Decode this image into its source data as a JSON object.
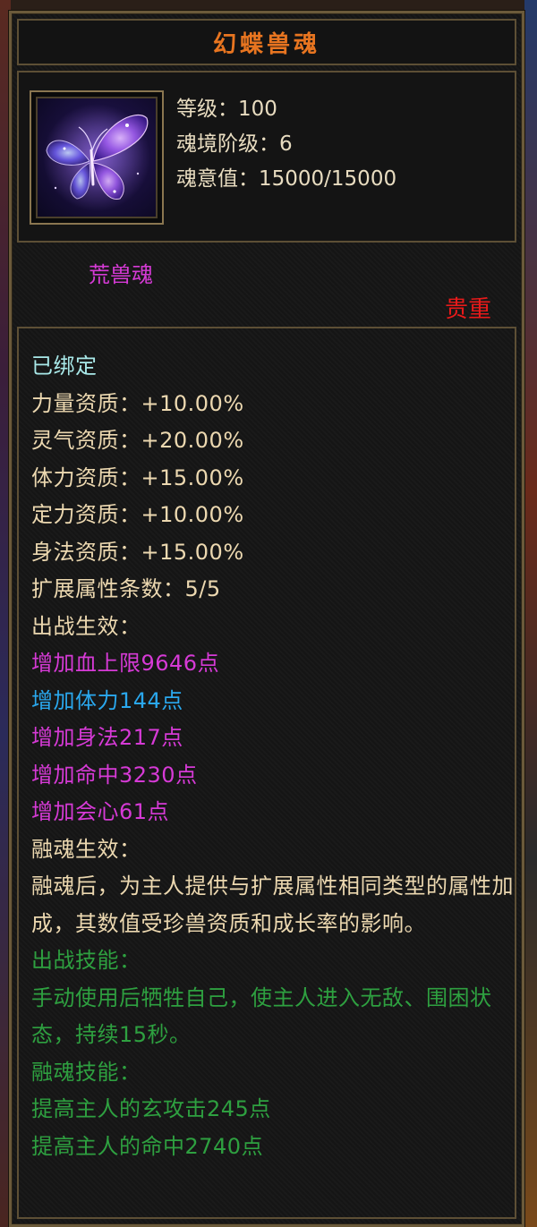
{
  "item": {
    "name": "幻蝶兽魂",
    "icon": "butterfly-soul-icon",
    "stats": [
      "等级：100",
      "魂境阶级：6",
      "魂意值：15000/15000"
    ],
    "category": "荒兽魂",
    "preciousness": "贵重"
  },
  "details": {
    "bound": "已绑定",
    "aptitudes": [
      "力量资质：+10.00%",
      "灵气资质：+20.00%",
      "体力资质：+15.00%",
      "定力资质：+10.00%",
      "身法资质：+15.00%"
    ],
    "ext_count": "扩展属性条数：5/5",
    "battle_effect_heading": "出战生效：",
    "battle_effects": [
      {
        "text": "增加血上限9646点",
        "color": "#d63ad6"
      },
      {
        "text": "增加体力144点",
        "color": "#2aa8ee"
      },
      {
        "text": "增加身法217点",
        "color": "#d63ad6"
      },
      {
        "text": "增加命中3230点",
        "color": "#d63ad6"
      },
      {
        "text": "增加会心61点",
        "color": "#d63ad6"
      }
    ],
    "fuse_effect_heading": "融魂生效：",
    "fuse_effect_desc": "融魂后，为主人提供与扩展属性相同类型的属性加成，其数值受珍兽资质和成长率的影响。",
    "battle_skill_heading": "出战技能：",
    "battle_skill_desc": "手动使用后牺牲自己，使主人进入无敌、围困状态，持续15秒。",
    "fuse_skill_heading": "融魂技能：",
    "fuse_skills": [
      "提高主人的玄攻击245点",
      "提高主人的命中2740点"
    ]
  },
  "colors": {
    "title": "#e87520",
    "category": "#d63ad6",
    "preciousness": "#e81a1a",
    "bound": "#a8e8e8",
    "normal_text": "#ecd8b0",
    "skill_text": "#2ea040"
  }
}
